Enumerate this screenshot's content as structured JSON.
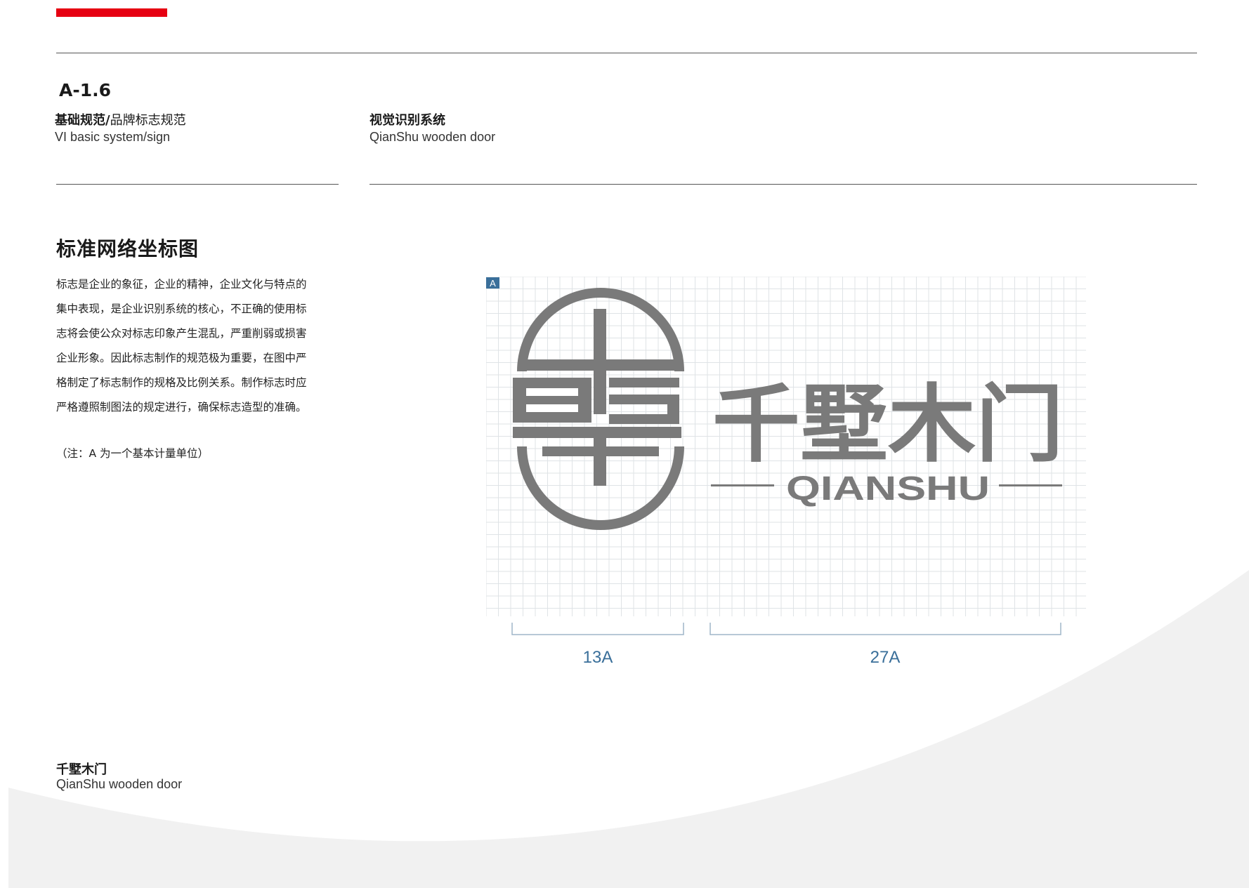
{
  "header": {
    "page_code": "A-1.6",
    "category_zh_bold": "基础规范/",
    "category_zh": "品牌标志规范",
    "category_en": "VI basic system/sign",
    "system_zh": "视觉识别系统",
    "system_en": "QianShu wooden door"
  },
  "section": {
    "title": "标准网络坐标图",
    "description": "标志是企业的象征，企业的精神，企业文化与特点的集中表现，是企业识别系统的核心，不正确的使用标志将会使公众对标志印象产生混乱，严重削弱或损害企业形象。因此标志制作的规范极为重要，在图中严格制定了标志制作的规格及比例关系。制作标志时应严格遵照制图法的规定进行，确保标志造型的准确。",
    "note": "（注：A 为一个基本计量单位）"
  },
  "logo": {
    "grid_unit_label": "A",
    "brand_zh": "千墅木门",
    "brand_en": "QIANSHU",
    "logo_color": "#7a7a7a",
    "grid_color": "#dfe3e6",
    "unit_badge_color": "#3a6f9a"
  },
  "dimensions": {
    "emblem_width": "13A",
    "wordmark_width": "27A"
  },
  "footer": {
    "brand_zh": "千墅木门",
    "brand_en": "QianShu wooden door"
  },
  "colors": {
    "accent_red": "#e60012",
    "dimension_blue": "#3a6f9a",
    "background_curve": "#f1f1f1"
  }
}
